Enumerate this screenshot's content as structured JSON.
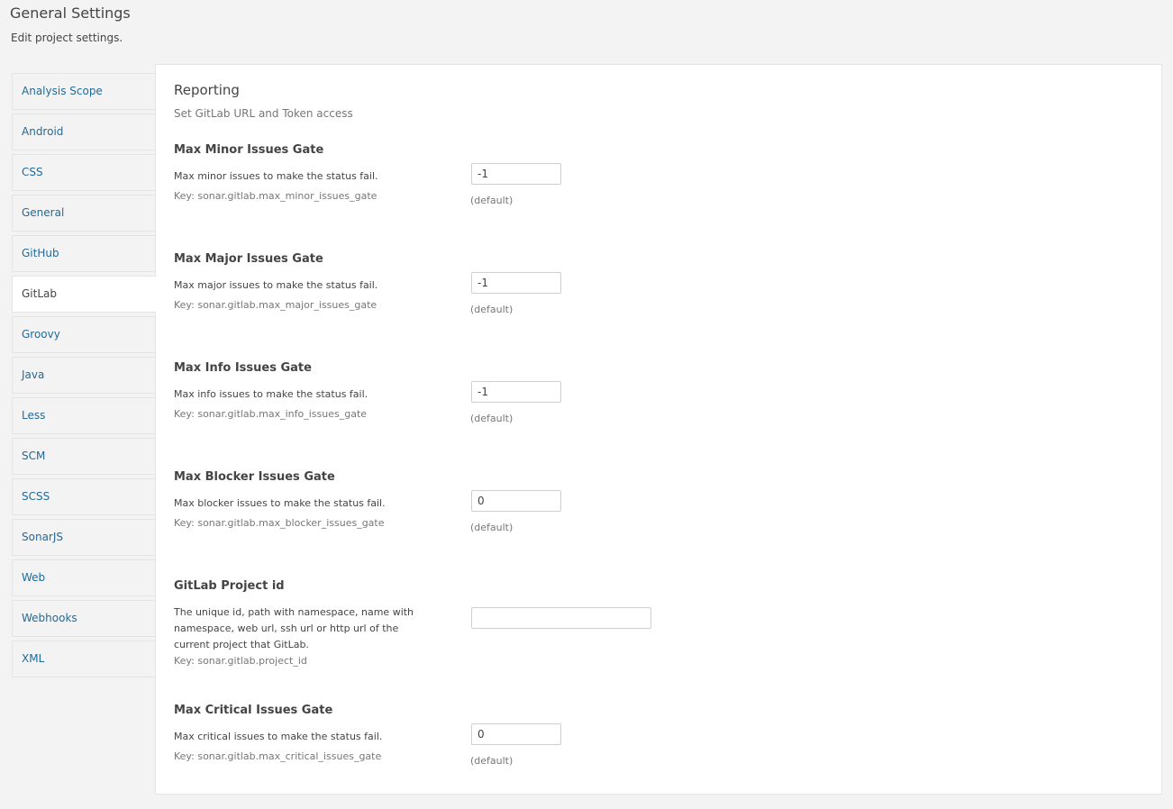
{
  "header": {
    "title": "General Settings",
    "description": "Edit project settings."
  },
  "sidebar": {
    "items": [
      {
        "label": "Analysis Scope"
      },
      {
        "label": "Android"
      },
      {
        "label": "CSS"
      },
      {
        "label": "General"
      },
      {
        "label": "GitHub"
      },
      {
        "label": "GitLab",
        "active": true
      },
      {
        "label": "Groovy"
      },
      {
        "label": "Java"
      },
      {
        "label": "Less"
      },
      {
        "label": "SCM"
      },
      {
        "label": "SCSS"
      },
      {
        "label": "SonarJS"
      },
      {
        "label": "Web"
      },
      {
        "label": "Webhooks"
      },
      {
        "label": "XML"
      }
    ]
  },
  "panel": {
    "title": "Reporting",
    "description": "Set GitLab URL and Token access",
    "settings": [
      {
        "name": "Max Minor Issues Gate",
        "description": "Max minor issues to make the status fail.",
        "key": "Key: sonar.gitlab.max_minor_issues_gate",
        "value": "-1",
        "default_note": "(default)"
      },
      {
        "name": "Max Major Issues Gate",
        "description": "Max major issues to make the status fail.",
        "key": "Key: sonar.gitlab.max_major_issues_gate",
        "value": "-1",
        "default_note": "(default)"
      },
      {
        "name": "Max Info Issues Gate",
        "description": "Max info issues to make the status fail.",
        "key": "Key: sonar.gitlab.max_info_issues_gate",
        "value": "-1",
        "default_note": "(default)"
      },
      {
        "name": "Max Blocker Issues Gate",
        "description": "Max blocker issues to make the status fail.",
        "key": "Key: sonar.gitlab.max_blocker_issues_gate",
        "value": "0",
        "default_note": "(default)"
      },
      {
        "name": "GitLab Project id",
        "description": "The unique id, path with namespace, name with namespace, web url, ssh url or http url of the current project that GitLab.",
        "key": "Key: sonar.gitlab.project_id",
        "value": ""
      },
      {
        "name": "Max Critical Issues Gate",
        "description": "Max critical issues to make the status fail.",
        "key": "Key: sonar.gitlab.max_critical_issues_gate",
        "value": "0",
        "default_note": "(default)"
      }
    ]
  }
}
